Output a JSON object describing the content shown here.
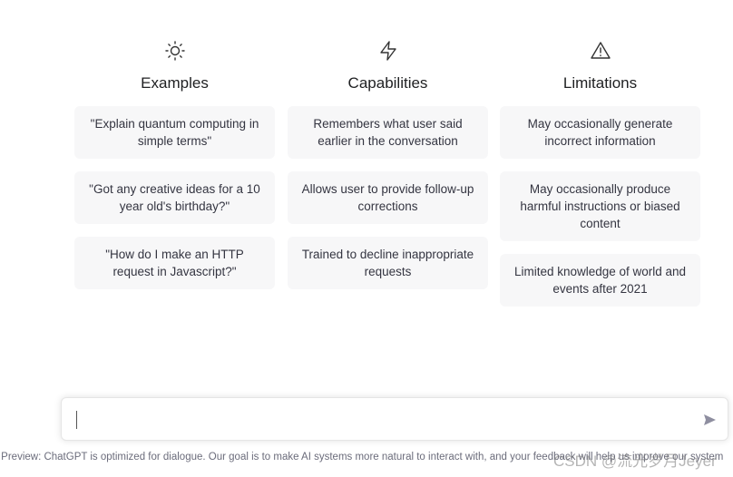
{
  "columns": [
    {
      "title": "Examples",
      "icon": "sun-icon",
      "items": [
        "\"Explain quantum computing in simple terms\"",
        "\"Got any creative ideas for a 10 year old's birthday?\"",
        "\"How do I make an HTTP request in Javascript?\""
      ]
    },
    {
      "title": "Capabilities",
      "icon": "lightning-icon",
      "items": [
        "Remembers what user said earlier in the conversation",
        "Allows user to provide follow-up corrections",
        "Trained to decline inappropriate requests"
      ]
    },
    {
      "title": "Limitations",
      "icon": "warning-icon",
      "items": [
        "May occasionally generate incorrect information",
        "May occasionally produce harmful instructions or biased content",
        "Limited knowledge of world and events after 2021"
      ]
    }
  ],
  "input": {
    "value": "",
    "placeholder": ""
  },
  "footer": "rch Preview: ChatGPT is optimized for dialogue. Our goal is to make AI systems more natural to interact with, and your feedback will help us improve our system",
  "watermark": "CSDN @流光岁月Jeyer"
}
